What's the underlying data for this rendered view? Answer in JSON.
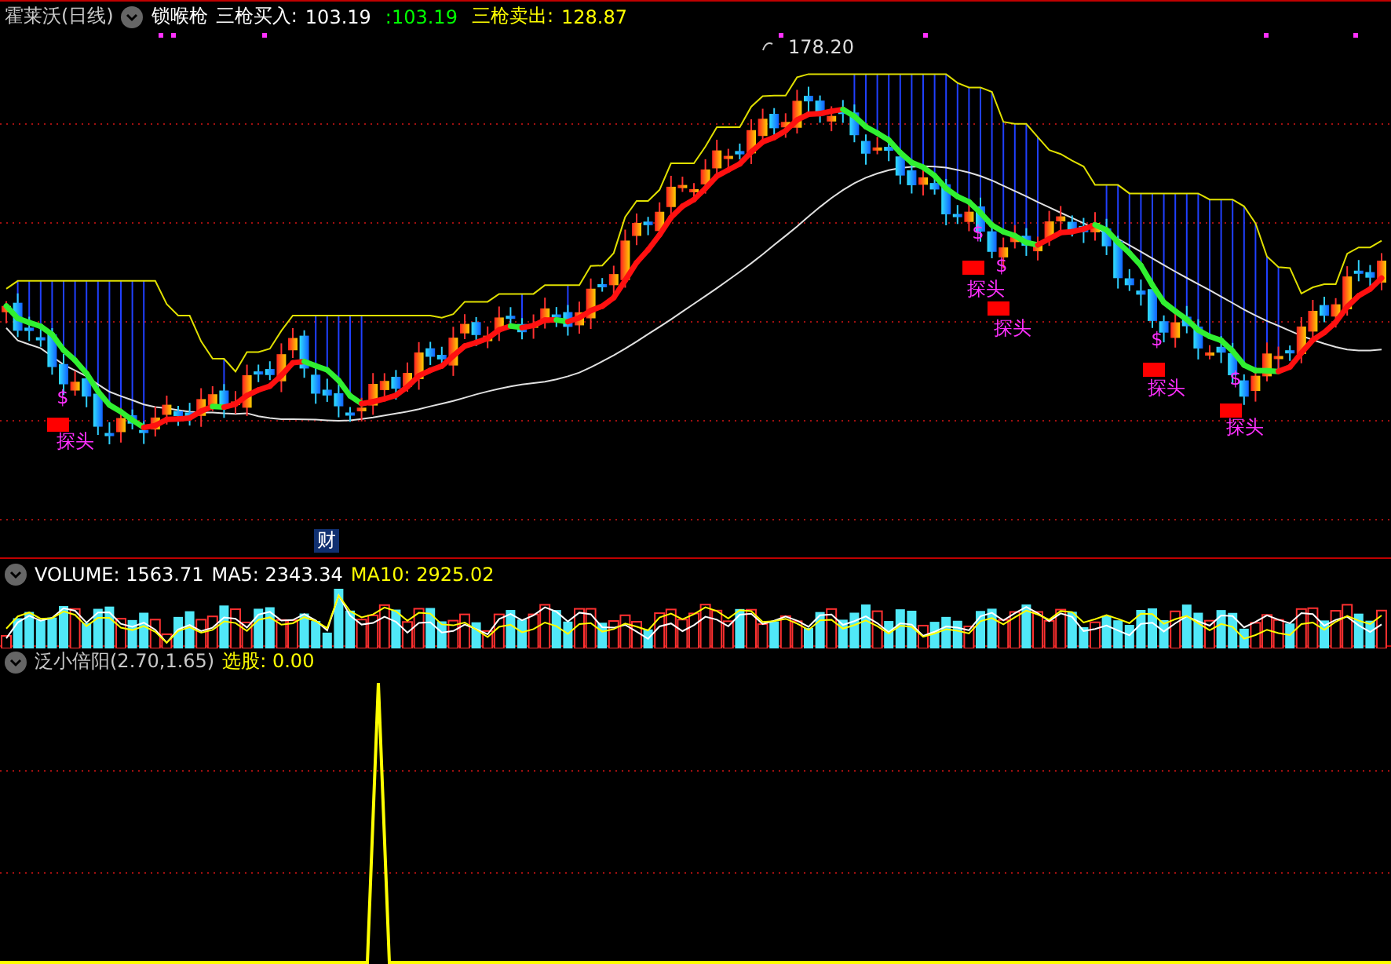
{
  "main": {
    "stock": "霍莱沃(日线)",
    "indicator": "锁喉枪",
    "readings": [
      {
        "label": "三枪买入:",
        "value": "103.19",
        "color": "#ffffff"
      },
      {
        "value": ":103.19",
        "color": "#00ff00"
      },
      {
        "label": "三枪卖出:",
        "value": "128.87",
        "color": "#ffff00"
      }
    ],
    "peak_label": "178.20",
    "signals": [
      {
        "sign": "$",
        "label": "探头"
      },
      {
        "sign": "$",
        "label": "探头"
      },
      {
        "sign": "$",
        "label": "探头"
      },
      {
        "sign": "$",
        "label": "探头"
      },
      {
        "sign": "$",
        "label": "探头"
      }
    ],
    "finance_mark": "财"
  },
  "volume": {
    "readings": [
      {
        "text": "VOLUME: 1563.71",
        "color": "#ffffff"
      },
      {
        "text": "MA5: 2343.34",
        "color": "#ffffff"
      },
      {
        "text": "MA10: 2925.02",
        "color": "#ffff00"
      }
    ]
  },
  "indicator": {
    "name": "泛小倍阳(2.70,1.65)",
    "readings": [
      {
        "text": "选股: 0.00",
        "color": "#ffff00"
      }
    ]
  }
}
